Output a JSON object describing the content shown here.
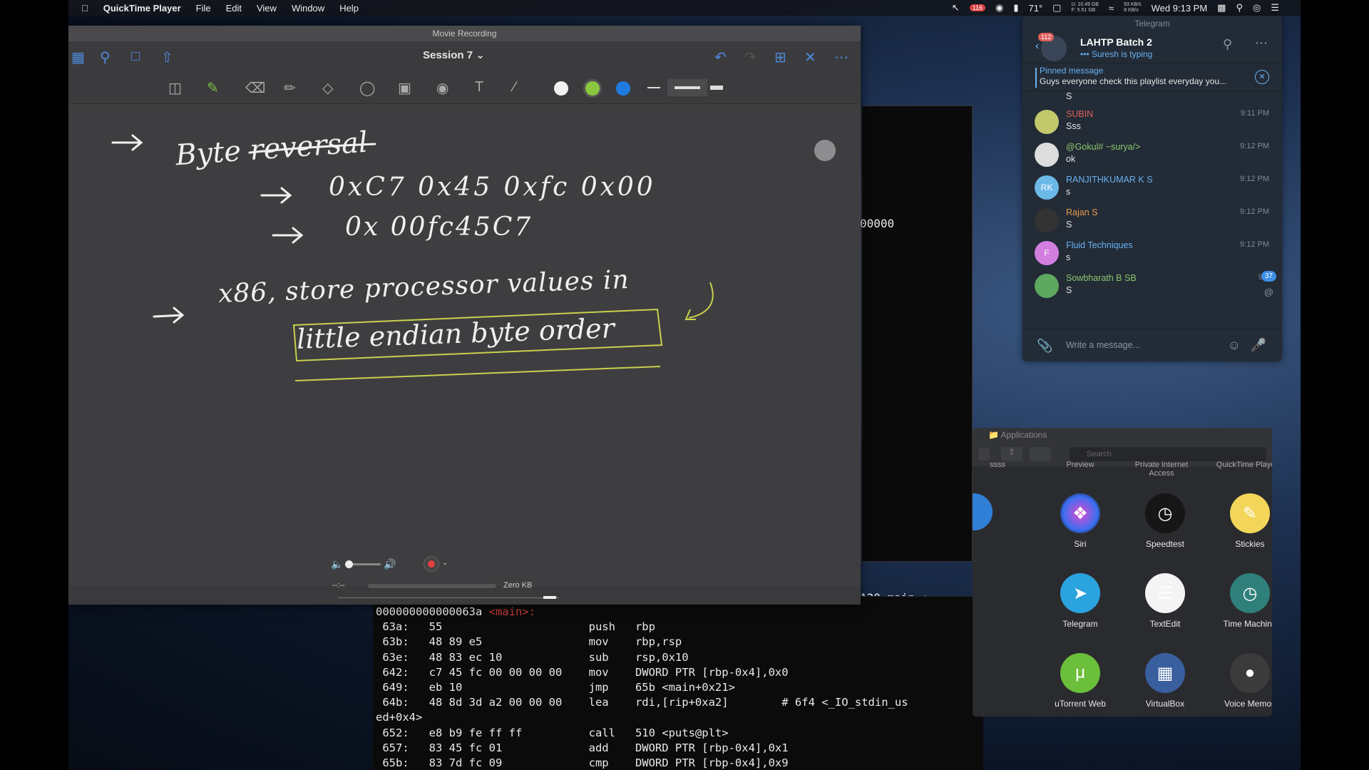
{
  "menubar": {
    "app": "QuickTime Player",
    "items": [
      "File",
      "Edit",
      "View",
      "Window",
      "Help"
    ],
    "badge": "116",
    "temperature": "71°",
    "disk_u": "U: 10.49 GB",
    "disk_f": "F: 5.51 GB",
    "net_up": "93 KB/s",
    "net_down": "8 KB/s",
    "datetime": "Wed 9:13 PM"
  },
  "notes": {
    "title": "Movie Recording",
    "session": "Session 7",
    "colors": {
      "white": "#f2f2f2",
      "green": "#8cc63f",
      "blue": "#1f7ae0"
    },
    "handwriting": {
      "line1": "Byte reversal",
      "line2": "0xC7   0x45   0xfc   0x00",
      "line3": "0x 00fc45C7",
      "line4": "x86, store processor values in",
      "line5": "little endian byte order"
    }
  },
  "quicktime": {
    "size": "Zero KB",
    "time": "--:--"
  },
  "terminal": {
    "right_fragment": "00000",
    "main_fragment": "A20 main.:",
    "lines": [
      "000000000000063a <main>:",
      " 63a:   55                      push   rbp",
      " 63b:   48 89 e5                mov    rbp,rsp",
      " 63e:   48 83 ec 10             sub    rsp,0x10",
      " 642:   c7 45 fc 00 00 00 00    mov    DWORD PTR [rbp-0x4],0x0",
      " 649:   eb 10                   jmp    65b <main+0x21>",
      " 64b:   48 8d 3d a2 00 00 00    lea    rdi,[rip+0xa2]        # 6f4 <_IO_stdin_us",
      "ed+0x4>",
      " 652:   e8 b9 fe ff ff          call   510 <puts@plt>",
      " 657:   83 45 fc 01             add    DWORD PTR [rbp-0x4],0x1",
      " 65b:   83 7d fc 09             cmp    DWORD PTR [rbp-0x4],0x9"
    ]
  },
  "telegram": {
    "title": "Telegram",
    "unread": "112",
    "chat_name": "LAHTP Batch 2",
    "typing": "Suresh is typing",
    "pinned_title": "Pinned message",
    "pinned_text": "Guys everyone check this playlist everyday you...",
    "top_partial": "S",
    "messages": [
      {
        "name": "SUBIN",
        "text": "Sss",
        "time": "9:11 PM",
        "color": "#e0605e",
        "avatar_color": "#c2c96d",
        "initials": ""
      },
      {
        "name": "@Gokul# ~surya/>",
        "text": "ok",
        "time": "9:12 PM",
        "color": "#8dc66d",
        "avatar_color": "#ddd",
        "initials": ""
      },
      {
        "name": "RANJITHKUMAR K S",
        "text": "s",
        "time": "9:12 PM",
        "color": "#6ab2f2",
        "avatar_color": "#6cb9e8",
        "initials": "RK"
      },
      {
        "name": "Rajan S",
        "text": "S",
        "time": "9:12 PM",
        "color": "#e59b4b",
        "avatar_color": "#333",
        "initials": ""
      },
      {
        "name": "Fluid Techniques",
        "text": "s",
        "time": "9:12 PM",
        "color": "#6ab2f2",
        "avatar_color": "#d27ee0",
        "initials": "F"
      },
      {
        "name": "Sowbharath B SB",
        "text": "S",
        "time": "9:1",
        "color": "#8dc66d",
        "avatar_color": "#5ea860",
        "initials": ""
      }
    ],
    "unread_bubble": "37",
    "input_placeholder": "Write a message..."
  },
  "applications": {
    "title": "Applications",
    "search_placeholder": "Search",
    "partial_headers": [
      "ssss",
      "Preview",
      "Private Internet Access",
      "QuickTime Player"
    ],
    "apps": [
      {
        "name": "Siri",
        "icon": "siri-icon"
      },
      {
        "name": "Speedtest",
        "icon": "speedtest-icon"
      },
      {
        "name": "Stickies",
        "icon": "stickies-icon"
      },
      {
        "name": "Telegram",
        "icon": "telegram-icon"
      },
      {
        "name": "TextEdit",
        "icon": "textedit-icon"
      },
      {
        "name": "Time Machine",
        "icon": "time-machine-icon"
      },
      {
        "name": "uTorrent Web",
        "icon": "utorrent-icon"
      },
      {
        "name": "VirtualBox",
        "icon": "virtualbox-icon"
      },
      {
        "name": "Voice Memos",
        "icon": "voice-memos-icon"
      }
    ]
  }
}
